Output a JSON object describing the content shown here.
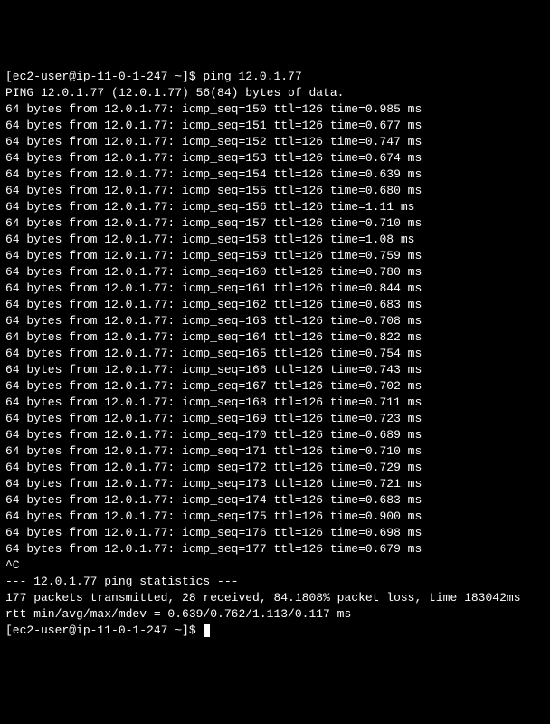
{
  "prompt_user": "ec2-user",
  "prompt_host": "ip-11-0-1-247",
  "prompt_path": "~",
  "command": "ping 12.0.1.77",
  "ping_header": "PING 12.0.1.77 (12.0.1.77) 56(84) bytes of data.",
  "reply_ip": "12.0.1.77",
  "reply_bytes": 64,
  "reply_ttl": 126,
  "replies": [
    {
      "seq": 150,
      "time": "0.985"
    },
    {
      "seq": 151,
      "time": "0.677"
    },
    {
      "seq": 152,
      "time": "0.747"
    },
    {
      "seq": 153,
      "time": "0.674"
    },
    {
      "seq": 154,
      "time": "0.639"
    },
    {
      "seq": 155,
      "time": "0.680"
    },
    {
      "seq": 156,
      "time": "1.11"
    },
    {
      "seq": 157,
      "time": "0.710"
    },
    {
      "seq": 158,
      "time": "1.08"
    },
    {
      "seq": 159,
      "time": "0.759"
    },
    {
      "seq": 160,
      "time": "0.780"
    },
    {
      "seq": 161,
      "time": "0.844"
    },
    {
      "seq": 162,
      "time": "0.683"
    },
    {
      "seq": 163,
      "time": "0.708"
    },
    {
      "seq": 164,
      "time": "0.822"
    },
    {
      "seq": 165,
      "time": "0.754"
    },
    {
      "seq": 166,
      "time": "0.743"
    },
    {
      "seq": 167,
      "time": "0.702"
    },
    {
      "seq": 168,
      "time": "0.711"
    },
    {
      "seq": 169,
      "time": "0.723"
    },
    {
      "seq": 170,
      "time": "0.689"
    },
    {
      "seq": 171,
      "time": "0.710"
    },
    {
      "seq": 172,
      "time": "0.729"
    },
    {
      "seq": 173,
      "time": "0.721"
    },
    {
      "seq": 174,
      "time": "0.683"
    },
    {
      "seq": 175,
      "time": "0.900"
    },
    {
      "seq": 176,
      "time": "0.698"
    },
    {
      "seq": 177,
      "time": "0.679"
    }
  ],
  "interrupt": "^C",
  "stats_header": "--- 12.0.1.77 ping statistics ---",
  "stats_packets": "177 packets transmitted, 28 received, 84.1808% packet loss, time 183042ms",
  "stats_rtt": "rtt min/avg/max/mdev = 0.639/0.762/1.113/0.117 ms"
}
